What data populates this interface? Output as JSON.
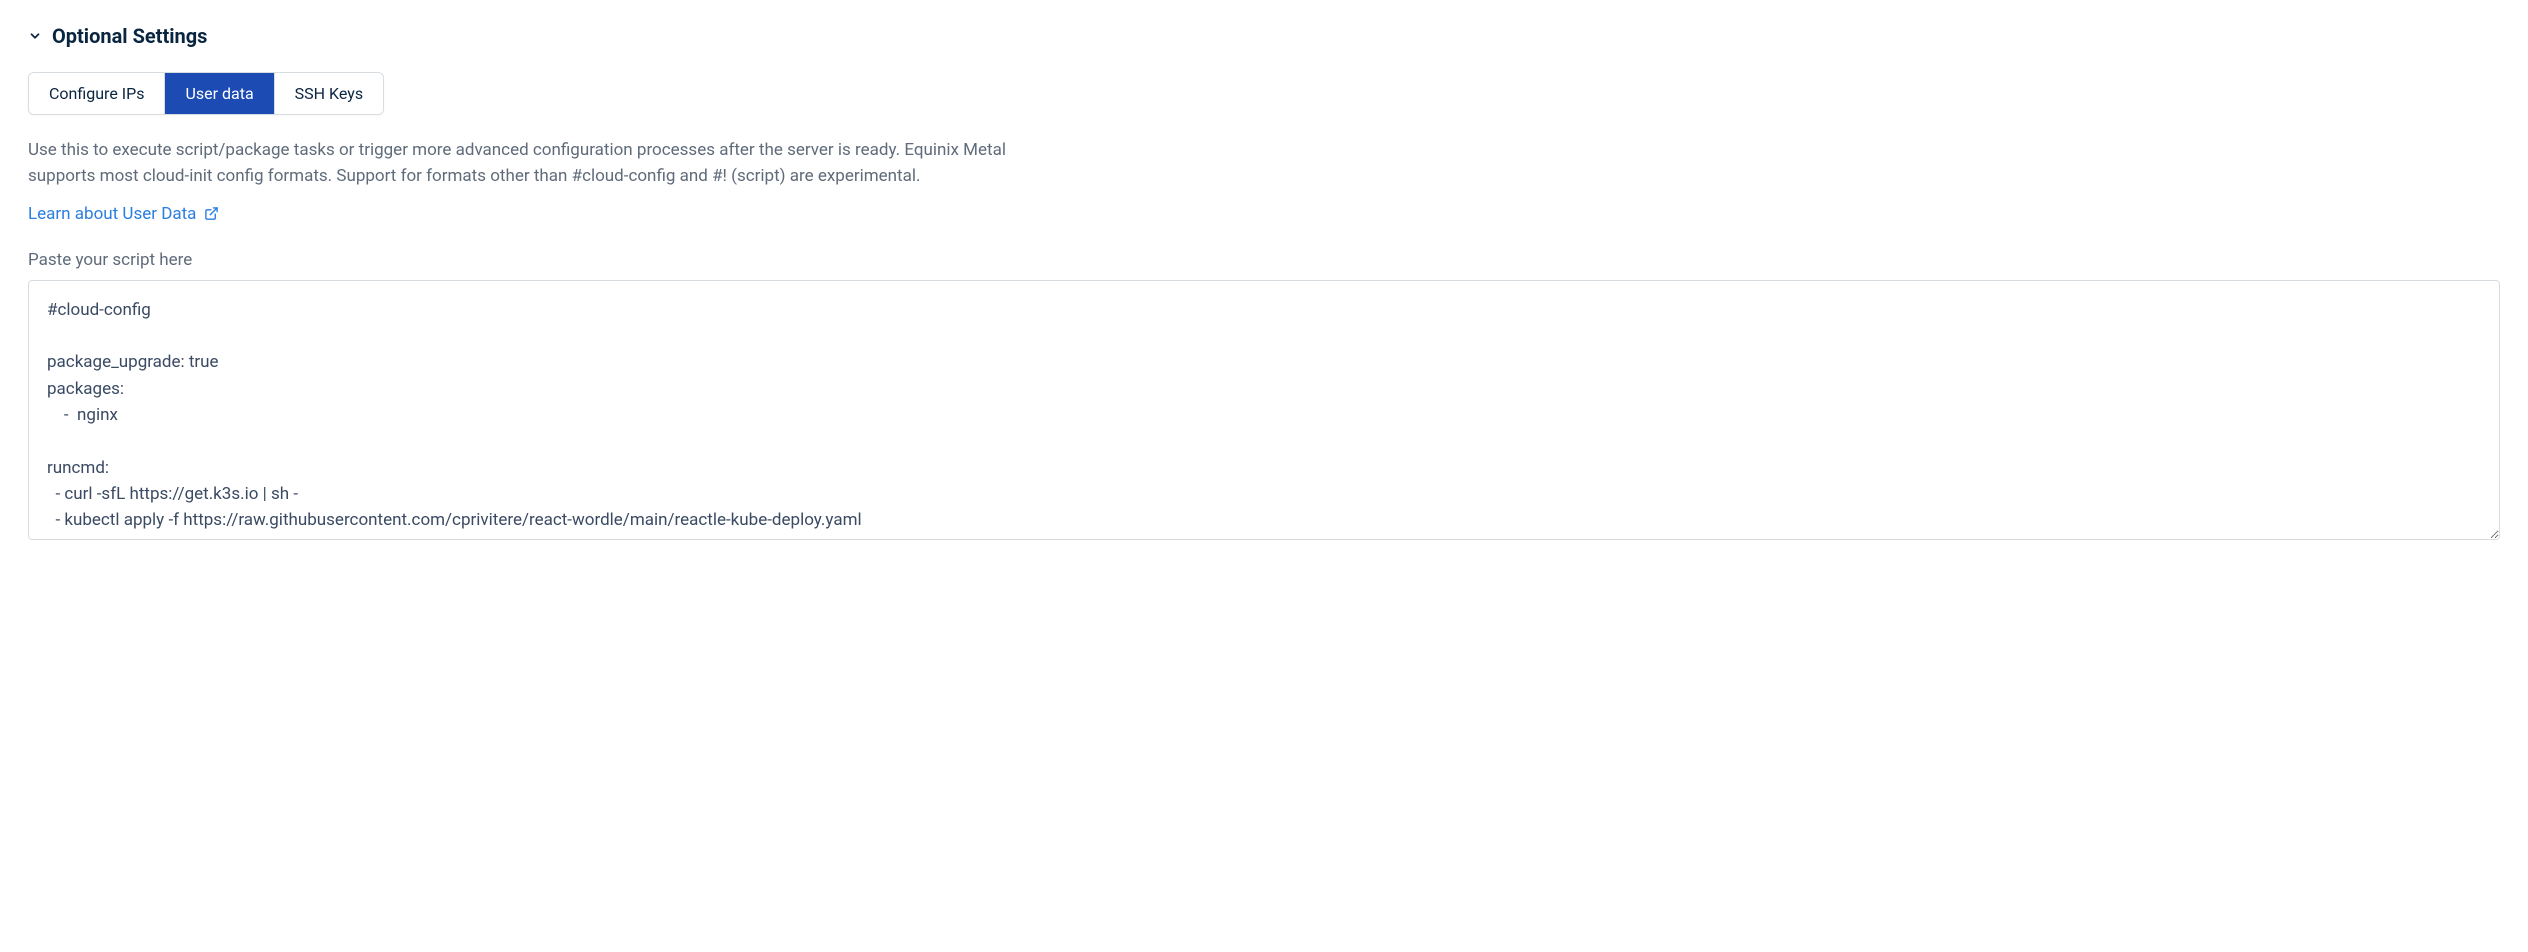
{
  "section": {
    "title": "Optional Settings"
  },
  "tabs": [
    {
      "label": "Configure IPs",
      "active": false
    },
    {
      "label": "User data",
      "active": true
    },
    {
      "label": "SSH Keys",
      "active": false
    }
  ],
  "userdata": {
    "description": "Use this to execute script/package tasks or trigger more advanced configuration processes after the server is ready. Equinix Metal supports most cloud-init config formats. Support for formats other than #cloud-config and #! (script) are experimental.",
    "learn_link_label": "Learn about User Data",
    "field_label": "Paste your script here",
    "script_value": "#cloud-config\n\npackage_upgrade: true\npackages:\n    -  nginx\n\nruncmd:\n  - curl -sfL https://get.k3s.io | sh -\n  - kubectl apply -f https://raw.githubusercontent.com/cprivitere/react-wordle/main/reactle-kube-deploy.yaml"
  }
}
